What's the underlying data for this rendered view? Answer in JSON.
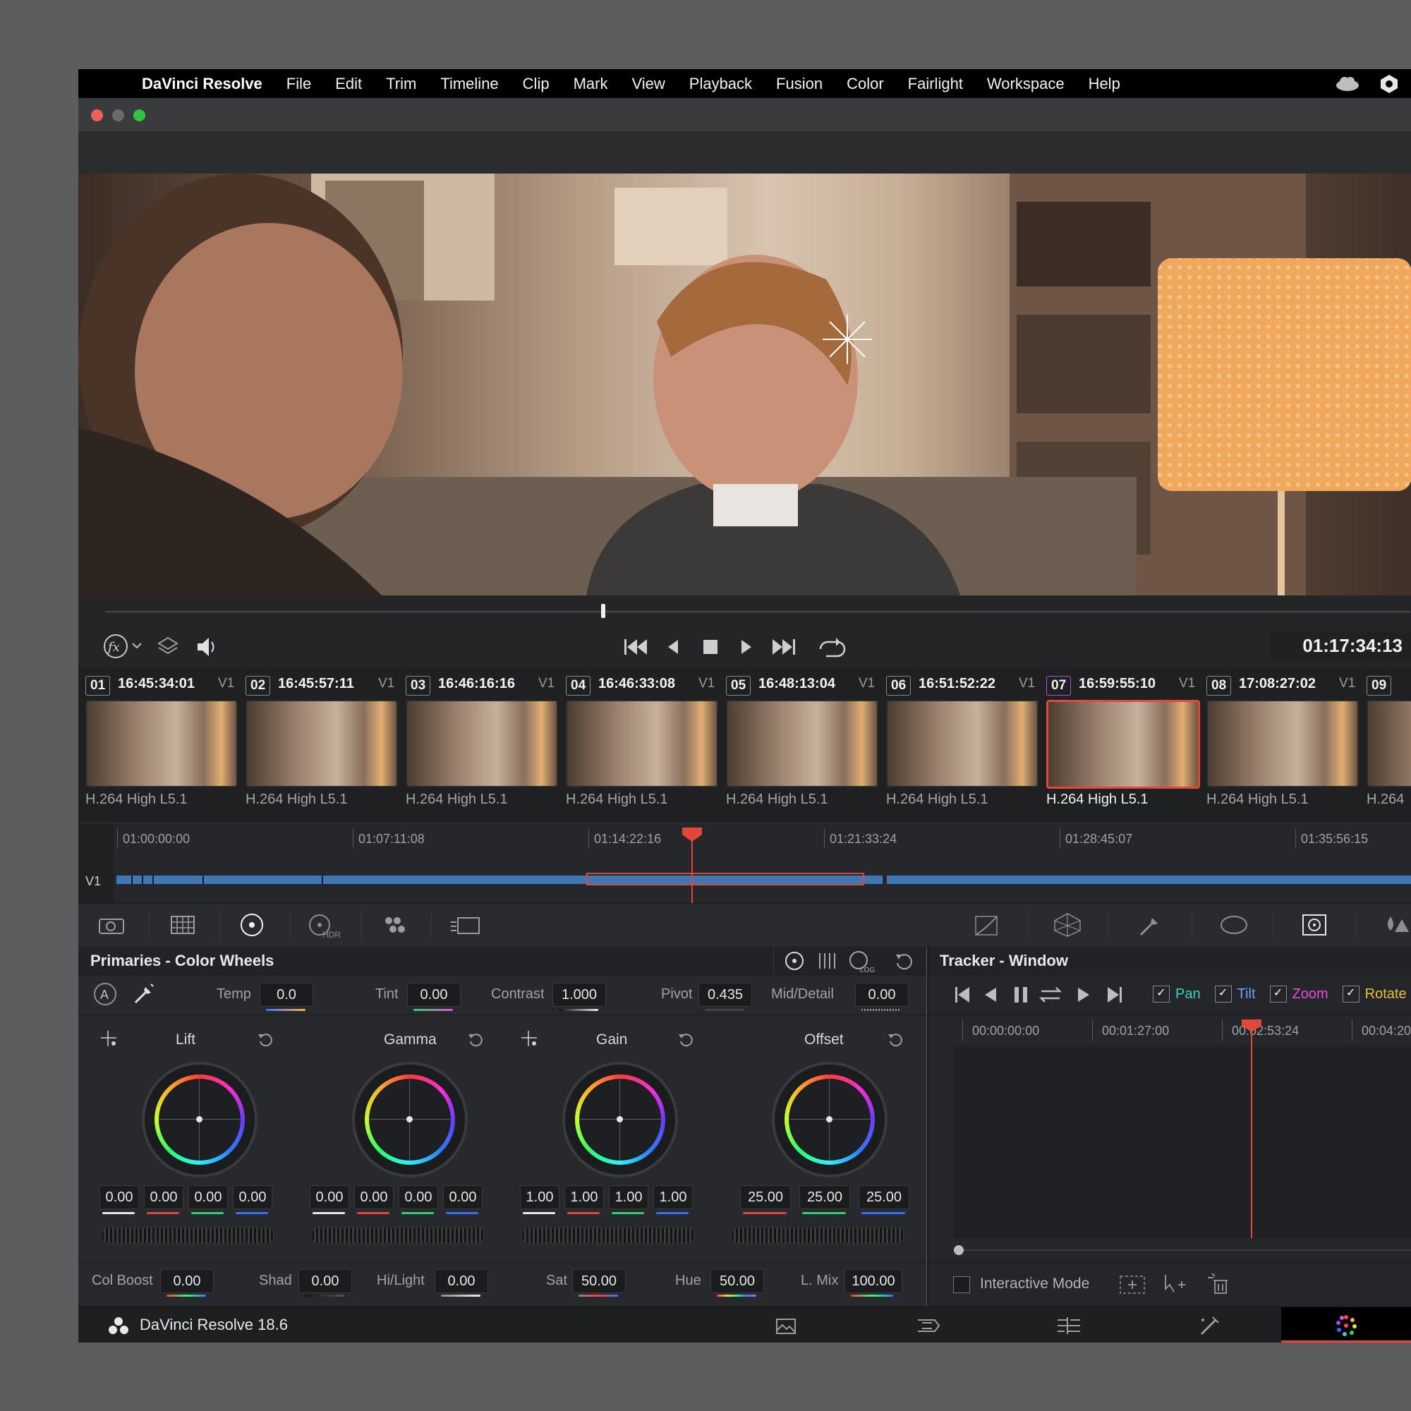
{
  "menubar": {
    "app_name": "DaVinci Resolve",
    "items": [
      "File",
      "Edit",
      "Trim",
      "Timeline",
      "Clip",
      "Mark",
      "View",
      "Playback",
      "Fusion",
      "Color",
      "Fairlight",
      "Workspace",
      "Help"
    ]
  },
  "viewer": {
    "timecode": "01:17:34:13",
    "playhead_fraction": 0.38
  },
  "clips": [
    {
      "num": "01",
      "tc": "16:45:34:01",
      "track": "V1",
      "codec": "H.264 High L5.1"
    },
    {
      "num": "02",
      "tc": "16:45:57:11",
      "track": "V1",
      "codec": "H.264 High L5.1"
    },
    {
      "num": "03",
      "tc": "16:46:16:16",
      "track": "V1",
      "codec": "H.264 High L5.1"
    },
    {
      "num": "04",
      "tc": "16:46:33:08",
      "track": "V1",
      "codec": "H.264 High L5.1"
    },
    {
      "num": "05",
      "tc": "16:48:13:04",
      "track": "V1",
      "codec": "H.264 High L5.1"
    },
    {
      "num": "06",
      "tc": "16:51:52:22",
      "track": "V1",
      "codec": "H.264 High L5.1"
    },
    {
      "num": "07",
      "tc": "16:59:55:10",
      "track": "V1",
      "codec": "H.264 High L5.1",
      "selected": true
    },
    {
      "num": "08",
      "tc": "17:08:27:02",
      "track": "V1",
      "codec": "H.264 High L5.1"
    },
    {
      "num": "09",
      "tc": "",
      "track": "",
      "codec": "H.264"
    }
  ],
  "mini_timeline": {
    "track": "V1",
    "ticks": [
      "01:00:00:00",
      "01:07:11:08",
      "01:14:22:16",
      "01:21:33:24",
      "01:28:45:07",
      "01:35:56:15"
    ]
  },
  "primaries": {
    "title": "Primaries - Color Wheels",
    "temp_label": "Temp",
    "temp": "0.0",
    "tint_label": "Tint",
    "tint": "0.00",
    "contrast_label": "Contrast",
    "contrast": "1.000",
    "pivot_label": "Pivot",
    "pivot": "0.435",
    "middetail_label": "Mid/Detail",
    "middetail": "0.00",
    "auto_label": "A",
    "wheels": [
      {
        "name": "Lift",
        "values": [
          "0.00",
          "0.00",
          "0.00",
          "0.00"
        ]
      },
      {
        "name": "Gamma",
        "values": [
          "0.00",
          "0.00",
          "0.00",
          "0.00"
        ]
      },
      {
        "name": "Gain",
        "values": [
          "1.00",
          "1.00",
          "1.00",
          "1.00"
        ]
      },
      {
        "name": "Offset",
        "values": [
          "25.00",
          "25.00",
          "25.00"
        ]
      }
    ],
    "colboost_label": "Col Boost",
    "colboost": "0.00",
    "shad_label": "Shad",
    "shad": "0.00",
    "hilight_label": "Hi/Light",
    "hilight": "0.00",
    "sat_label": "Sat",
    "sat": "50.00",
    "hue_label": "Hue",
    "hue": "50.00",
    "lmix_label": "L. Mix",
    "lmix": "100.00"
  },
  "tracker": {
    "title": "Tracker - Window",
    "pan": "Pan",
    "tilt": "Tilt",
    "zoom": "Zoom",
    "rotate": "Rotate",
    "ticks": [
      "00:00:00:00",
      "00:01:27:00",
      "00:02:53:24",
      "00:04:20"
    ],
    "interactive_mode": "Interactive Mode"
  },
  "footer": {
    "app_version": "DaVinci Resolve 18.6"
  },
  "colors": {
    "accent_red": "#e3473a",
    "clip_blue": "#3f79b5",
    "pan": "#39d1c6",
    "tilt": "#6aa2ff",
    "zoom": "#e64ce0",
    "rotate": "#e6c23a"
  }
}
